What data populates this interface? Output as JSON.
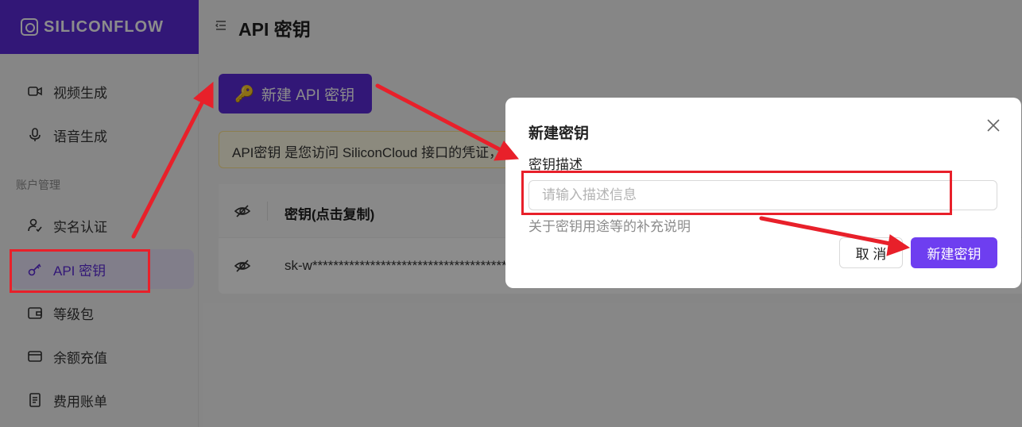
{
  "brand": {
    "name": "SILICONFLOW"
  },
  "sidebar": {
    "section_label": "账户管理",
    "items": [
      {
        "label": "视频生成",
        "icon": "video-icon"
      },
      {
        "label": "语音生成",
        "icon": "microphone-icon"
      },
      {
        "label": "实名认证",
        "icon": "user-check-icon"
      },
      {
        "label": "API 密钥",
        "icon": "key-icon",
        "active": true
      },
      {
        "label": "等级包",
        "icon": "wallet-icon"
      },
      {
        "label": "余额充值",
        "icon": "credit-card-icon"
      },
      {
        "label": "费用账单",
        "icon": "bill-icon"
      }
    ]
  },
  "header": {
    "title": "API 密钥"
  },
  "main": {
    "create_button": "新建 API 密钥",
    "notice": "API密钥 是您访问 SiliconCloud 接口的凭证，",
    "table": {
      "header_key": "密钥(点击复制)",
      "rows": [
        {
          "key": "sk-w*****************************************"
        }
      ]
    }
  },
  "modal": {
    "title": "新建密钥",
    "field_label": "密钥描述",
    "placeholder": "请输入描述信息",
    "value": "",
    "help": "关于密钥用途等的补充说明",
    "cancel": "取 消",
    "ok": "新建密钥"
  },
  "colors": {
    "brand": "#5b2bd9",
    "primary_button": "#6e3ef0",
    "annotation": "#e8202a"
  }
}
